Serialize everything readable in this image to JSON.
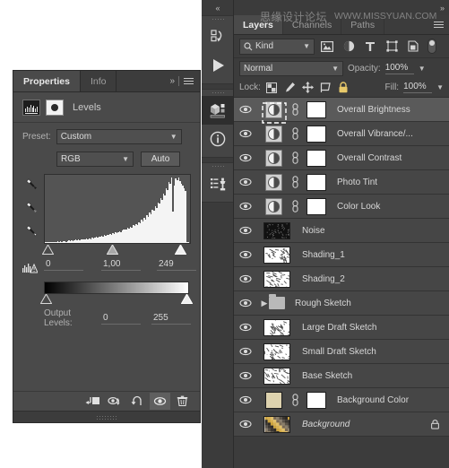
{
  "properties_panel": {
    "tabs": [
      {
        "label": "Properties",
        "active": true
      },
      {
        "label": "Info",
        "active": false
      }
    ],
    "title": "Levels",
    "adjustment_icon": "levels-histogram-icon",
    "preset": {
      "label": "Preset:",
      "value": "Custom"
    },
    "channel": {
      "value": "RGB"
    },
    "auto_button": "Auto",
    "eyedroppers": [
      "set-black-point-eyedropper",
      "set-gray-point-eyedropper",
      "set-white-point-eyedropper"
    ],
    "input_levels": {
      "shadow": "0",
      "midtone": "1,00",
      "highlight": "249"
    },
    "output_levels": {
      "label": "Output Levels:",
      "black": "0",
      "white": "255"
    },
    "bottom_buttons": [
      "clip-to-layer-button",
      "view-previous-state-button",
      "reset-adjustment-button",
      "toggle-layer-visibility-button",
      "delete-adjustment-layer-button"
    ],
    "histogram": [
      1,
      1,
      1,
      1,
      2,
      2,
      1,
      2,
      2,
      3,
      2,
      3,
      2,
      3,
      3,
      2,
      3,
      4,
      3,
      4,
      3,
      4,
      5,
      4,
      5,
      4,
      6,
      5,
      6,
      5,
      7,
      6,
      7,
      6,
      8,
      7,
      8,
      9,
      8,
      10,
      9,
      11,
      10,
      12,
      11,
      13,
      12,
      14,
      13,
      15,
      14,
      16,
      15,
      17,
      18,
      17,
      19,
      20,
      21,
      20,
      23,
      22,
      25,
      24,
      27,
      26,
      29,
      28,
      32,
      30,
      35,
      33,
      38,
      36,
      42,
      40,
      46,
      44,
      51,
      49,
      56,
      54,
      62,
      60,
      68,
      66,
      76,
      73,
      84,
      81,
      93,
      90,
      100,
      48,
      88,
      99,
      96,
      100,
      94,
      90,
      88,
      84,
      80,
      2,
      1
    ]
  },
  "icon_dock": {
    "collapse": "collapse-panels-icon",
    "groups": [
      {
        "buttons": [
          {
            "icon": "history-actions-icon",
            "active": false
          },
          {
            "icon": "play-button-icon",
            "active": false
          }
        ]
      },
      {
        "buttons": [
          {
            "icon": "mini-bridge-icon",
            "active": true
          },
          {
            "icon": "info-icon",
            "active": false
          }
        ]
      },
      {
        "buttons": [
          {
            "icon": "clone-source-icon",
            "active": false
          }
        ]
      }
    ]
  },
  "layers_panel": {
    "tabs": [
      {
        "label": "Layers",
        "active": true
      },
      {
        "label": "Channels",
        "active": false
      },
      {
        "label": "Paths",
        "active": false
      }
    ],
    "filter": {
      "kind_label": "Kind",
      "icons": [
        "filter-pixel-icon",
        "filter-adjustment-icon",
        "filter-type-icon",
        "filter-shape-icon",
        "filter-smart-object-icon"
      ],
      "toggle": "filter-enable-toggle"
    },
    "blend_mode": "Normal",
    "opacity_label": "Opacity:",
    "opacity_value": "100%",
    "lock_label": "Lock:",
    "lock_icons": [
      "lock-transparent-pixels-icon",
      "lock-image-pixels-icon",
      "lock-position-icon",
      "lock-artboard-nesting-icon",
      "lock-all-icon"
    ],
    "fill_label": "Fill:",
    "fill_value": "100%",
    "layers": [
      {
        "name": "Overall Brightness",
        "type": "adjustment",
        "selected": true,
        "has_mask": true,
        "linked": true,
        "visible": true,
        "italic": false,
        "locked": false
      },
      {
        "name": "Overall Vibrance/...",
        "type": "adjustment",
        "selected": false,
        "has_mask": true,
        "linked": true,
        "visible": true,
        "italic": false,
        "locked": false
      },
      {
        "name": "Overall Contrast",
        "type": "adjustment",
        "selected": false,
        "has_mask": true,
        "linked": true,
        "visible": true,
        "italic": false,
        "locked": false
      },
      {
        "name": "Photo Tint",
        "type": "adjustment",
        "selected": false,
        "has_mask": true,
        "linked": true,
        "visible": true,
        "italic": false,
        "locked": false
      },
      {
        "name": "Color Look",
        "type": "adjustment",
        "selected": false,
        "has_mask": true,
        "linked": true,
        "visible": true,
        "italic": false,
        "locked": false
      },
      {
        "name": "Noise",
        "type": "noise",
        "selected": false,
        "has_mask": false,
        "linked": false,
        "visible": true,
        "italic": false,
        "locked": false
      },
      {
        "name": "Shading_1",
        "type": "sketch",
        "selected": false,
        "has_mask": false,
        "linked": false,
        "visible": true,
        "italic": false,
        "locked": false
      },
      {
        "name": "Shading_2",
        "type": "sketch",
        "selected": false,
        "has_mask": false,
        "linked": false,
        "visible": true,
        "italic": false,
        "locked": false
      },
      {
        "name": "Rough Sketch",
        "type": "group",
        "selected": false,
        "has_mask": false,
        "linked": false,
        "visible": true,
        "italic": false,
        "locked": false
      },
      {
        "name": "Large Draft Sketch",
        "type": "sketch",
        "selected": false,
        "has_mask": false,
        "linked": false,
        "visible": true,
        "italic": false,
        "locked": false
      },
      {
        "name": "Small Draft Sketch",
        "type": "sketch",
        "selected": false,
        "has_mask": false,
        "linked": false,
        "visible": true,
        "italic": false,
        "locked": false
      },
      {
        "name": "Base Sketch",
        "type": "sketch",
        "selected": false,
        "has_mask": false,
        "linked": false,
        "visible": true,
        "italic": false,
        "locked": false
      },
      {
        "name": "Background Color",
        "type": "solidcolor",
        "selected": false,
        "has_mask": true,
        "linked": true,
        "visible": true,
        "italic": false,
        "locked": false,
        "swatch": "#ddd2ae"
      },
      {
        "name": "Background",
        "type": "photo",
        "selected": false,
        "has_mask": false,
        "linked": false,
        "visible": true,
        "italic": true,
        "locked": true
      }
    ]
  },
  "watermark": {
    "cn": "思缘设计论坛",
    "en": "WWW.MISSYUAN.COM"
  },
  "colors": {
    "panel_bg": "#3c3c3c",
    "properties_bg": "#4a4a4a",
    "row_bg": "#464646",
    "row_selected": "#5a5a5a",
    "text": "#c8c8c8"
  }
}
